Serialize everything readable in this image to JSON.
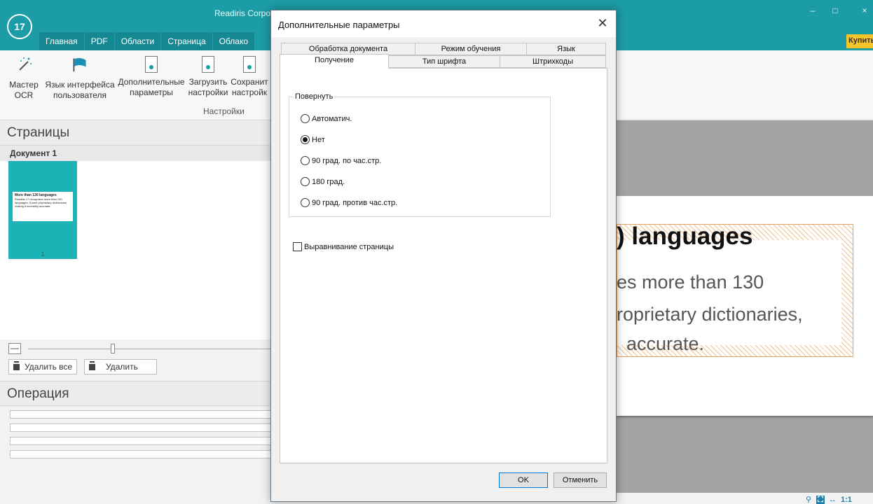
{
  "app": {
    "title": "Readiris Corpo",
    "logo_text": "17",
    "buy_label": "Купить",
    "window_controls": {
      "minimize": "–",
      "maximize": "□",
      "close": "×"
    }
  },
  "ribbon": {
    "tabs": [
      "Главная",
      "PDF",
      "Области",
      "Страница",
      "Облако"
    ],
    "buttons": [
      {
        "line1": "Мастер",
        "line2": "OCR",
        "icon": "magic-wand-icon"
      },
      {
        "line1": "Язык интерфейса",
        "line2": "пользователя",
        "icon": "flag-icon"
      },
      {
        "line1": "Дополнительные",
        "line2": "параметры",
        "icon": "settings-document-icon"
      },
      {
        "line1": "Загрузить",
        "line2": "настройки",
        "icon": "load-settings-icon"
      },
      {
        "line1": "Сохранит",
        "line2": "настройк",
        "icon": "save-settings-icon"
      }
    ],
    "group_label": "Настройки"
  },
  "pages_panel": {
    "title": "Страницы",
    "document_label": "Документ 1",
    "thumbnail": {
      "heading": "More than 130 languages",
      "text": "Readiris 17 recognizes more than 130 languages. It uses proprietary dictionaries making it incredibly accurate.",
      "page_number": "1"
    },
    "zoom_minus": "—",
    "delete_all_label": "Удалить все",
    "delete_label": "Удалить"
  },
  "operation_panel": {
    "title": "Операция"
  },
  "preview": {
    "heading": ") languages",
    "lines": [
      "es more than 130",
      "roprietary dictionaries,",
      "accurate."
    ],
    "zoom_label": "1:1"
  },
  "dialog": {
    "title": "Дополнительные параметры",
    "close": "✕",
    "tabs_row1": [
      "Обработка документа",
      "Режим обучения",
      "Язык"
    ],
    "tabs_row2": [
      "Получение",
      "Тип шрифта",
      "Штрихкоды"
    ],
    "active_tab": "Получение",
    "rotate": {
      "legend": "Повернуть",
      "options": [
        "Автоматич.",
        "Нет",
        "90 град. по час.стр.",
        "180 град.",
        "90 град. против час.стр."
      ],
      "selected_index": 1
    },
    "deskew": {
      "label": "Выравнивание страницы",
      "checked": false
    },
    "ok_label": "OK",
    "cancel_label": "Отменить"
  }
}
